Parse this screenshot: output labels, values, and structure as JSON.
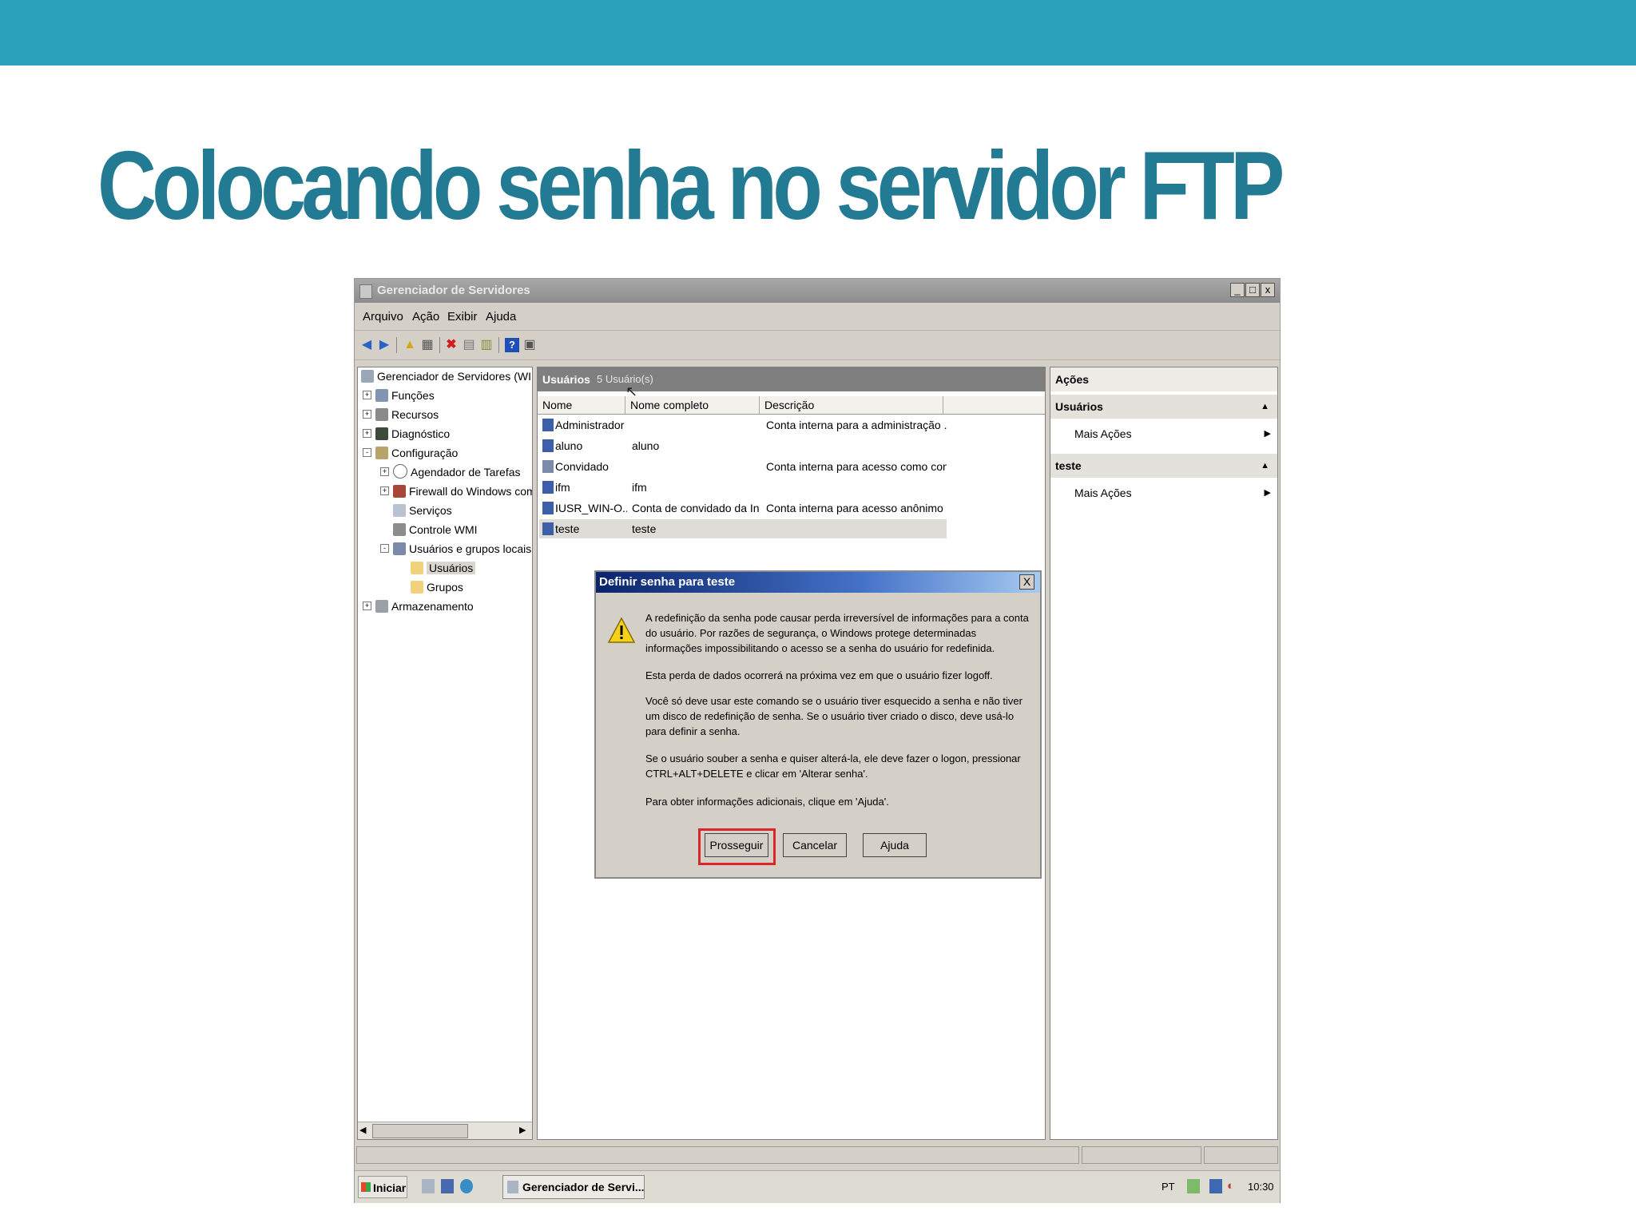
{
  "slide": {
    "title": "Colocando senha no servidor FTP"
  },
  "colors": {
    "topbar": "#2ba3bd",
    "title": "#237a93",
    "highlight": "#d9262a"
  },
  "window": {
    "title": "Gerenciador de Servidores",
    "controls": {
      "minimize": "_",
      "maximize": "□",
      "close": "x"
    },
    "menu": [
      "Arquivo",
      "Ação",
      "Exibir",
      "Ajuda"
    ],
    "toolbar_icons": [
      "back-arrow-icon",
      "forward-arrow-icon",
      "up-folder-icon",
      "show-hide-tree-icon",
      "delete-icon",
      "properties-icon",
      "export-list-icon",
      "help-icon",
      "console-icon"
    ]
  },
  "tree": [
    {
      "label": "Gerenciador de Servidores (WIN-OI",
      "expander": ""
    },
    {
      "label": "Funções",
      "expander": "+"
    },
    {
      "label": "Recursos",
      "expander": "+"
    },
    {
      "label": "Diagnóstico",
      "expander": "+"
    },
    {
      "label": "Configuração",
      "expander": "-"
    },
    {
      "label": "Agendador de Tarefas",
      "expander": "+"
    },
    {
      "label": "Firewall do Windows com Se",
      "expander": "+"
    },
    {
      "label": "Serviços",
      "expander": ""
    },
    {
      "label": "Controle WMI",
      "expander": ""
    },
    {
      "label": "Usuários e grupos locais",
      "expander": "-"
    },
    {
      "label": "Usuários",
      "expander": ""
    },
    {
      "label": "Grupos",
      "expander": ""
    },
    {
      "label": "Armazenamento",
      "expander": "+"
    }
  ],
  "center": {
    "header_title": "Usuários",
    "header_count": "5 Usuário(s)",
    "columns": [
      "Nome",
      "Nome completo",
      "Descrição"
    ],
    "rows": [
      {
        "name": "Administrador",
        "full": "",
        "desc": "Conta interna para a administração ..."
      },
      {
        "name": "aluno",
        "full": "aluno",
        "desc": ""
      },
      {
        "name": "Convidado",
        "full": "",
        "desc": "Conta interna para acesso como con..."
      },
      {
        "name": "ifm",
        "full": "ifm",
        "desc": ""
      },
      {
        "name": "IUSR_WIN-O...",
        "full": "Conta de convidado da In...",
        "desc": "Conta interna para acesso anônimo ..."
      },
      {
        "name": "teste",
        "full": "teste",
        "desc": ""
      }
    ]
  },
  "actions": {
    "title": "Ações",
    "sections": [
      {
        "header": "Usuários",
        "item": "Mais Ações"
      },
      {
        "header": "teste",
        "item": "Mais Ações"
      }
    ]
  },
  "dialog": {
    "title": "Definir senha para teste",
    "close": "X",
    "paragraphs": [
      "A redefinição da senha pode causar perda irreversível de informações para a conta do usuário. Por razões de segurança, o Windows protege determinadas informações impossibilitando o acesso se a senha do usuário for redefinida.",
      "Esta perda de dados ocorrerá na próxima vez em que o usuário fizer logoff.",
      "Você só deve usar este comando se o usuário tiver esquecido a senha e não tiver um disco de redefinição de senha. Se o usuário tiver criado o disco, deve usá-lo para definir a senha.",
      "Se o usuário souber a senha e quiser alterá-la, ele deve fazer o logon, pressionar CTRL+ALT+DELETE e clicar em 'Alterar senha'.",
      "Para obter informações adicionais, clique em 'Ajuda'."
    ],
    "buttons": {
      "proceed": "Prosseguir",
      "cancel": "Cancelar",
      "help": "Ajuda"
    }
  },
  "taskbar": {
    "start": "Iniciar",
    "task": "Gerenciador de Servi...",
    "language": "PT",
    "clock": "10:30"
  }
}
